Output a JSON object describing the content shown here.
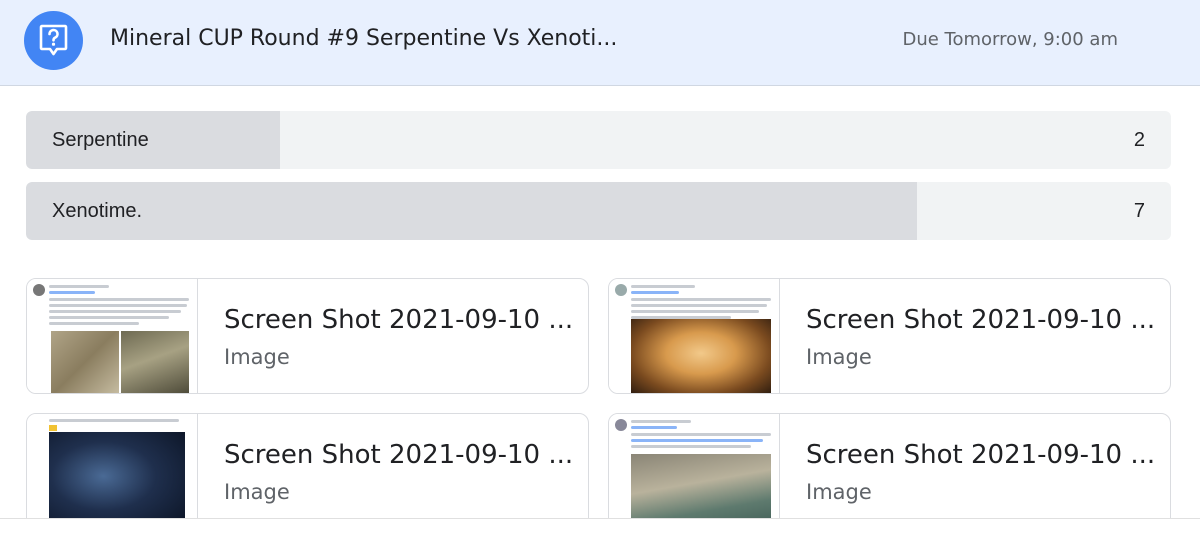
{
  "header": {
    "icon": "question-bubble-icon",
    "title": "Mineral CUP Round #9 Serpentine Vs Xenoti...",
    "due": "Due Tomorrow, 9:00 am",
    "accent_color": "#4285f4",
    "background_color": "#e8f0fe"
  },
  "poll": {
    "options": [
      {
        "label": "Serpentine",
        "count": "2",
        "share": 0.222
      },
      {
        "label": "Xenotime.",
        "count": "7",
        "share": 0.778
      }
    ]
  },
  "attachments": [
    {
      "name": "Screen Shot 2021-09-10 ...",
      "type": "Image"
    },
    {
      "name": "Screen Shot 2021-09-10 ...",
      "type": "Image"
    },
    {
      "name": "Screen Shot 2021-09-10 ...",
      "type": "Image"
    },
    {
      "name": "Screen Shot 2021-09-10 ...",
      "type": "Image"
    }
  ]
}
